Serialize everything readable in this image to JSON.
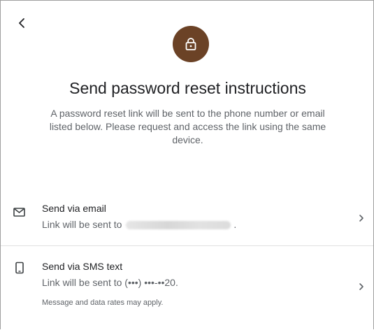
{
  "header": {
    "back_icon": "chevron-left-icon",
    "lock_icon": "lock-icon",
    "lock_color": "#6b4226"
  },
  "main": {
    "title": "Send password reset instructions",
    "description": "A password reset link will be sent to the phone number or email listed below. Please request and access the link using the same device."
  },
  "options": [
    {
      "icon": "envelope-icon",
      "title": "Send via email",
      "subtitle_prefix": "Link will be sent to",
      "subtitle_suffix": "."
    },
    {
      "icon": "phone-icon",
      "title": "Send via SMS text",
      "subtitle": "Link will be sent to (•••) •••-••20.",
      "note": "Message and data rates may apply."
    }
  ]
}
